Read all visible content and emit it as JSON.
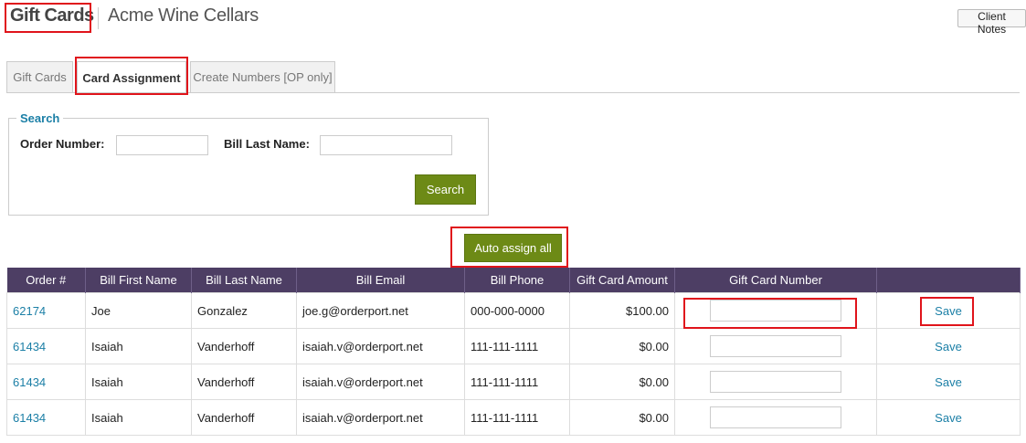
{
  "header": {
    "title": "Gift Cards",
    "company": "Acme Wine Cellars",
    "client_notes_label": "Client Notes"
  },
  "tabs": [
    {
      "label": "Gift Cards",
      "active": false
    },
    {
      "label": "Card Assignment",
      "active": true
    },
    {
      "label": "Create Numbers [OP only]",
      "active": false
    }
  ],
  "search": {
    "legend": "Search",
    "order_number_label": "Order Number:",
    "order_number_value": "",
    "bill_last_name_label": "Bill Last Name:",
    "bill_last_name_value": "",
    "search_button": "Search"
  },
  "auto_assign_label": "Auto assign all",
  "table": {
    "columns": [
      "Order #",
      "Bill First Name",
      "Bill Last Name",
      "Bill Email",
      "Bill Phone",
      "Gift Card Amount",
      "Gift Card Number",
      ""
    ],
    "rows": [
      {
        "order": "62174",
        "first": "Joe",
        "last": "Gonzalez",
        "email": "joe.g@orderport.net",
        "phone": "000-000-0000",
        "amount": "$100.00",
        "card_number": "",
        "action": "Save"
      },
      {
        "order": "61434",
        "first": "Isaiah",
        "last": "Vanderhoff",
        "email": "isaiah.v@orderport.net",
        "phone": "111-111-1111",
        "amount": "$0.00",
        "card_number": "",
        "action": "Save"
      },
      {
        "order": "61434",
        "first": "Isaiah",
        "last": "Vanderhoff",
        "email": "isaiah.v@orderport.net",
        "phone": "111-111-1111",
        "amount": "$0.00",
        "card_number": "",
        "action": "Save"
      },
      {
        "order": "61434",
        "first": "Isaiah",
        "last": "Vanderhoff",
        "email": "isaiah.v@orderport.net",
        "phone": "111-111-1111",
        "amount": "$0.00",
        "card_number": "",
        "action": "Save"
      }
    ]
  },
  "colors": {
    "header_bg": "#4d3e64",
    "button_green": "#6d8a16",
    "link_blue": "#1b7fa6",
    "highlight_red": "#e0141b"
  }
}
